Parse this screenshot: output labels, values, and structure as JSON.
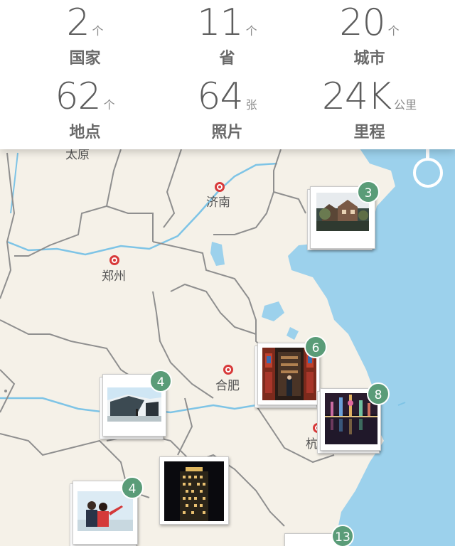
{
  "stats": [
    {
      "value": "2",
      "unit": "个",
      "label": "国家"
    },
    {
      "value": "11",
      "unit": "个",
      "label": "省"
    },
    {
      "value": "20",
      "unit": "个",
      "label": "城市"
    },
    {
      "value": "62",
      "unit": "个",
      "label": "地点"
    },
    {
      "value": "64",
      "unit": "张",
      "label": "照片"
    },
    {
      "value": "24K",
      "unit": "公里",
      "label": "里程"
    }
  ],
  "cities": {
    "taiyuan": "太原",
    "jinan": "济南",
    "zhengzhou": "郑州",
    "hefei": "合肥",
    "hangzhou": "杭"
  },
  "pins": {
    "shandong": {
      "count": "3"
    },
    "jiangsu": {
      "count": "6"
    },
    "shanghai": {
      "count": "8"
    },
    "henan": {
      "count": "4"
    },
    "hubei": {
      "count": "4"
    },
    "zhejiang": {
      "count": "13"
    }
  },
  "colors": {
    "land": "#f5f1e8",
    "sea": "#9cd1ec",
    "border": "#8f8f8f",
    "river": "#7ec4e6",
    "badge": "#5a9c78",
    "city_marker": "#d83a3a"
  },
  "icons": {
    "locate": "locate-me-icon",
    "city_marker": "city-marker-icon"
  }
}
